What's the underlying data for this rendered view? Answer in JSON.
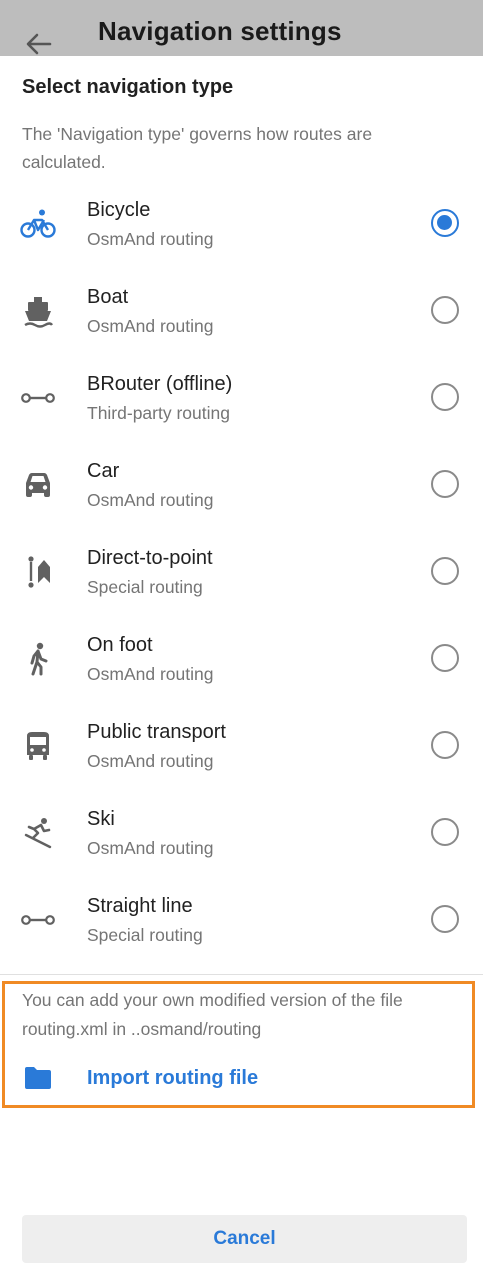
{
  "header": {
    "title": "Navigation settings",
    "back_icon": "arrow-back-icon"
  },
  "section": {
    "title": "Select navigation type",
    "description": "The 'Navigation type' governs how routes are calculated."
  },
  "types": [
    {
      "label": "Bicycle",
      "subtitle": "OsmAnd routing",
      "icon": "bicycle-icon",
      "selected": true
    },
    {
      "label": "Boat",
      "subtitle": "OsmAnd routing",
      "icon": "boat-icon",
      "selected": false
    },
    {
      "label": "BRouter (offline)",
      "subtitle": "Third-party routing",
      "icon": "straight-line-icon",
      "selected": false
    },
    {
      "label": "Car",
      "subtitle": "OsmAnd routing",
      "icon": "car-icon",
      "selected": false
    },
    {
      "label": "Direct-to-point",
      "subtitle": "Special routing",
      "icon": "direct-to-point-icon",
      "selected": false
    },
    {
      "label": "On foot",
      "subtitle": "OsmAnd routing",
      "icon": "pedestrian-icon",
      "selected": false
    },
    {
      "label": "Public transport",
      "subtitle": "OsmAnd routing",
      "icon": "bus-icon",
      "selected": false
    },
    {
      "label": "Ski",
      "subtitle": "OsmAnd routing",
      "icon": "ski-icon",
      "selected": false
    },
    {
      "label": "Straight line",
      "subtitle": "Special routing",
      "icon": "straight-line-icon",
      "selected": false
    }
  ],
  "import": {
    "hint": "You can add your own modified version of the file routing.xml in ..osmand/routing",
    "label": "Import routing file",
    "icon": "folder-icon"
  },
  "footer": {
    "cancel_label": "Cancel"
  },
  "colors": {
    "accent": "#2a7ad8",
    "highlight_border": "#f08a24",
    "topbar": "#bdbdbd",
    "icon": "#616161"
  }
}
